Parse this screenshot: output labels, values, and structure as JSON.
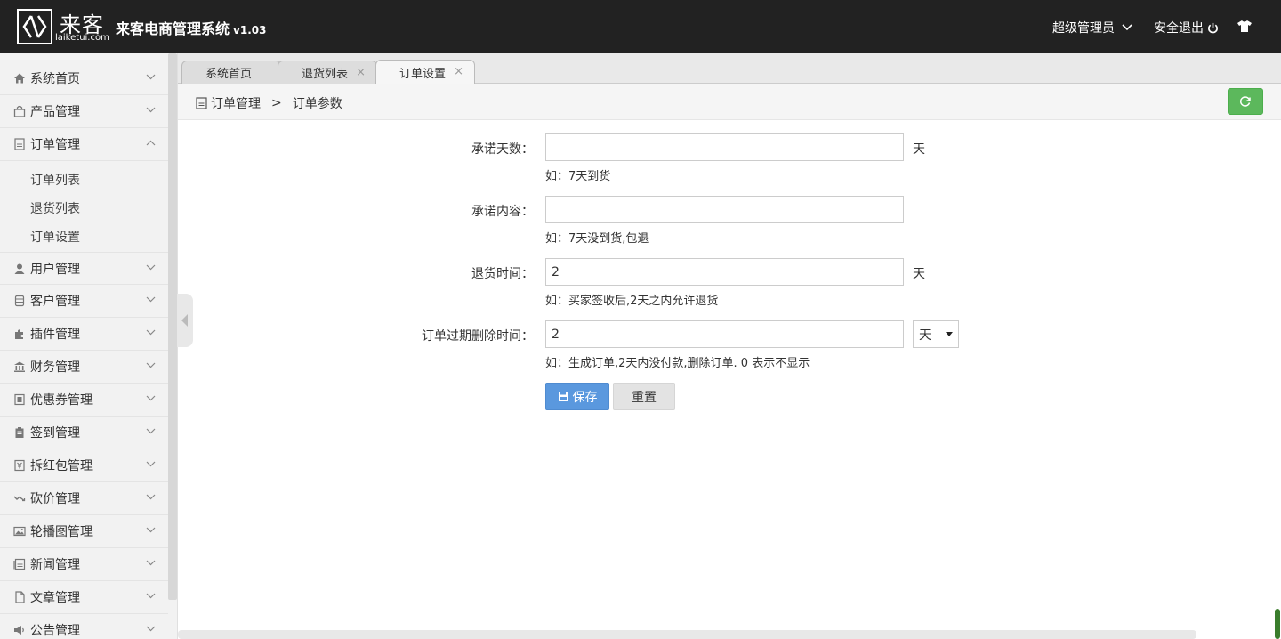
{
  "header": {
    "logo_cn": "来客",
    "logo_url": "laiketui.com",
    "title": "来客电商管理系统",
    "version": "v1.03",
    "user_label": "超级管理员",
    "logout_label": "安全退出",
    "icons": [
      "chevron-down-icon",
      "power-icon",
      "tshirt-icon"
    ]
  },
  "sidebar": {
    "items": [
      {
        "label": "系统首页",
        "icon": "home-icon",
        "expanded": false
      },
      {
        "label": "产品管理",
        "icon": "bag-icon",
        "expanded": false
      },
      {
        "label": "订单管理",
        "icon": "list-icon",
        "expanded": true
      },
      {
        "label": "用户管理",
        "icon": "user-icon",
        "expanded": false
      },
      {
        "label": "客户管理",
        "icon": "database-icon",
        "expanded": false
      },
      {
        "label": "插件管理",
        "icon": "puzzle-icon",
        "expanded": false
      },
      {
        "label": "财务管理",
        "icon": "bank-icon",
        "expanded": false
      },
      {
        "label": "优惠券管理",
        "icon": "coupon-icon",
        "expanded": false
      },
      {
        "label": "签到管理",
        "icon": "clipboard-icon",
        "expanded": false
      },
      {
        "label": "拆红包管理",
        "icon": "redpacket-icon",
        "expanded": false
      },
      {
        "label": "砍价管理",
        "icon": "trend-icon",
        "expanded": false
      },
      {
        "label": "轮播图管理",
        "icon": "image-icon",
        "expanded": false
      },
      {
        "label": "新闻管理",
        "icon": "news-icon",
        "expanded": false
      },
      {
        "label": "文章管理",
        "icon": "file-icon",
        "expanded": false
      },
      {
        "label": "公告管理",
        "icon": "megaphone-icon",
        "expanded": false
      }
    ],
    "order_subitems": [
      "订单列表",
      "退货列表",
      "订单设置"
    ]
  },
  "tabs": [
    {
      "label": "系统首页",
      "closable": false,
      "active": false
    },
    {
      "label": "退货列表",
      "closable": true,
      "active": false
    },
    {
      "label": "订单设置",
      "closable": true,
      "active": true
    }
  ],
  "tab_close_glyph": "×",
  "breadcrumb": {
    "parent": "订单管理",
    "separator": ">",
    "current": "订单参数"
  },
  "form": {
    "promise_days": {
      "label": "承诺天数：",
      "value": "",
      "unit": "天",
      "hint": "如：7天到货"
    },
    "promise_content": {
      "label": "承诺内容：",
      "value": "",
      "hint": "如：7天没到货,包退"
    },
    "return_time": {
      "label": "退货时间：",
      "value": "2",
      "unit": "天",
      "hint": "如：买家签收后,2天之内允许退货"
    },
    "expire_delete": {
      "label": "订单过期删除时间：",
      "value": "2",
      "unit_selected": "天",
      "hint": "如：生成订单,2天内没付款,删除订单. 0 表示不显示"
    },
    "save_label": "保存",
    "reset_label": "重置"
  },
  "colors": {
    "header_bg": "#222222",
    "save_btn": "#5a98de",
    "refresh_btn": "#5cb85c"
  }
}
